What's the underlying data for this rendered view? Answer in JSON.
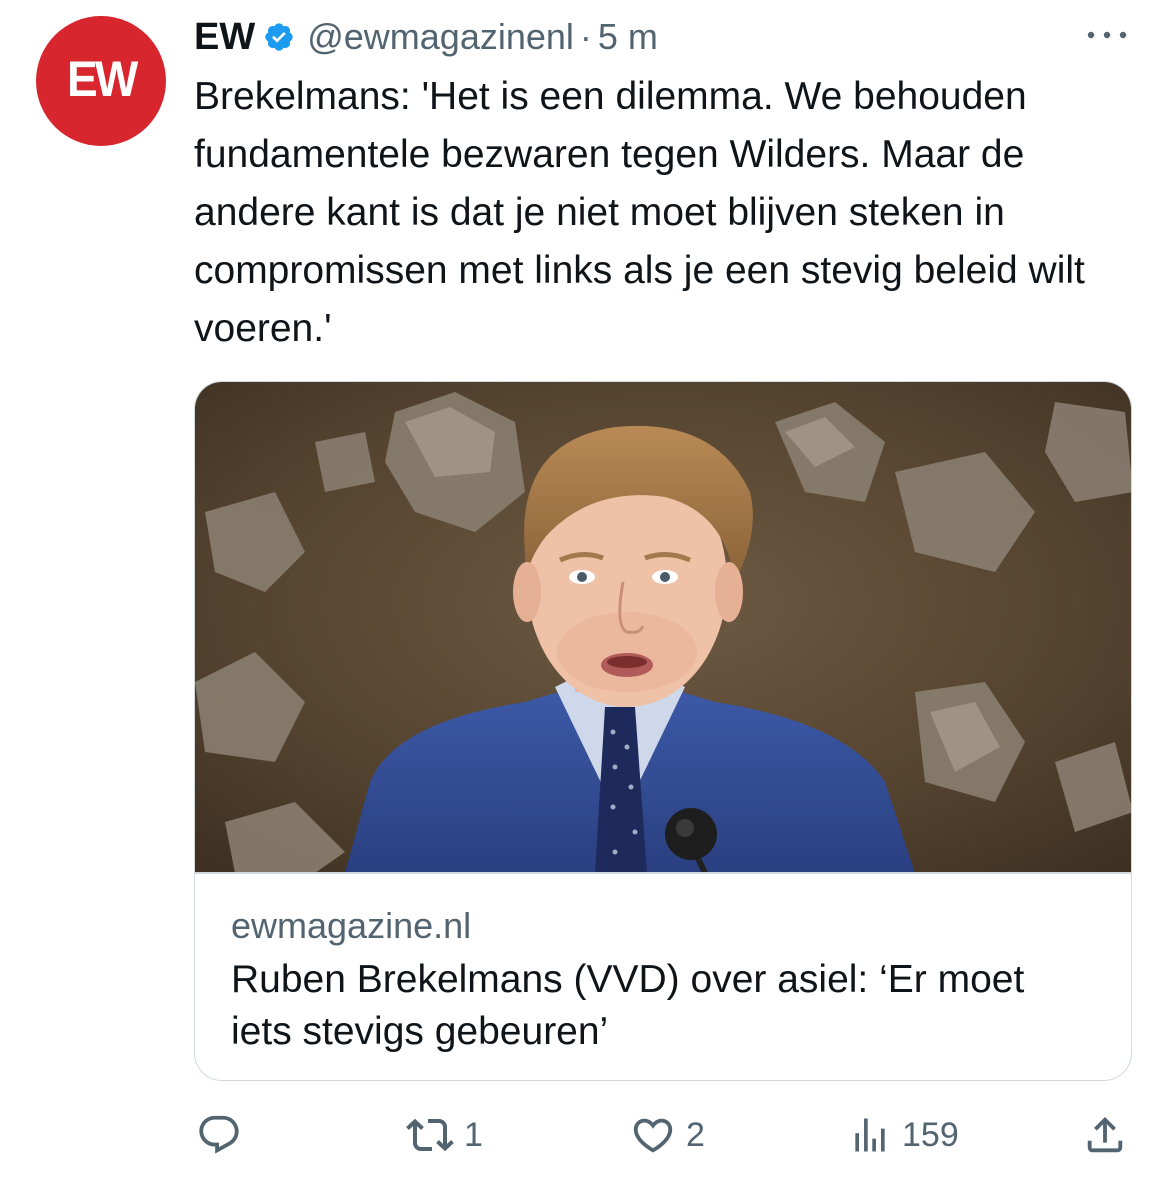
{
  "tweet": {
    "avatar_text": "EW",
    "display_name": "EW",
    "handle": "@ewmagazinenl",
    "separator": "·",
    "timestamp": "5 m",
    "text": "Brekelmans: 'Het is een dilemma. We behouden fundamentele bezwaren tegen Wilders. Maar de andere kant is dat je niet moet blijven steken in compromissen met links als je een stevig beleid wilt voeren.'"
  },
  "card": {
    "domain": "ewmagazine.nl",
    "title": "Ruben Brekelmans (VVD) over asiel: ‘Er moet iets stevigs gebeuren’"
  },
  "actions": {
    "reply_count": "",
    "retweet_count": "1",
    "like_count": "2",
    "views_count": "159"
  },
  "colors": {
    "brand_red": "#d7262e",
    "verified_blue": "#1d9bf0",
    "secondary_text": "#536471",
    "primary_text": "#0f1419",
    "border": "#cfd9de"
  },
  "icons": [
    "verified-badge-icon",
    "more-icon",
    "reply-icon",
    "retweet-icon",
    "like-icon",
    "views-icon",
    "share-icon"
  ]
}
